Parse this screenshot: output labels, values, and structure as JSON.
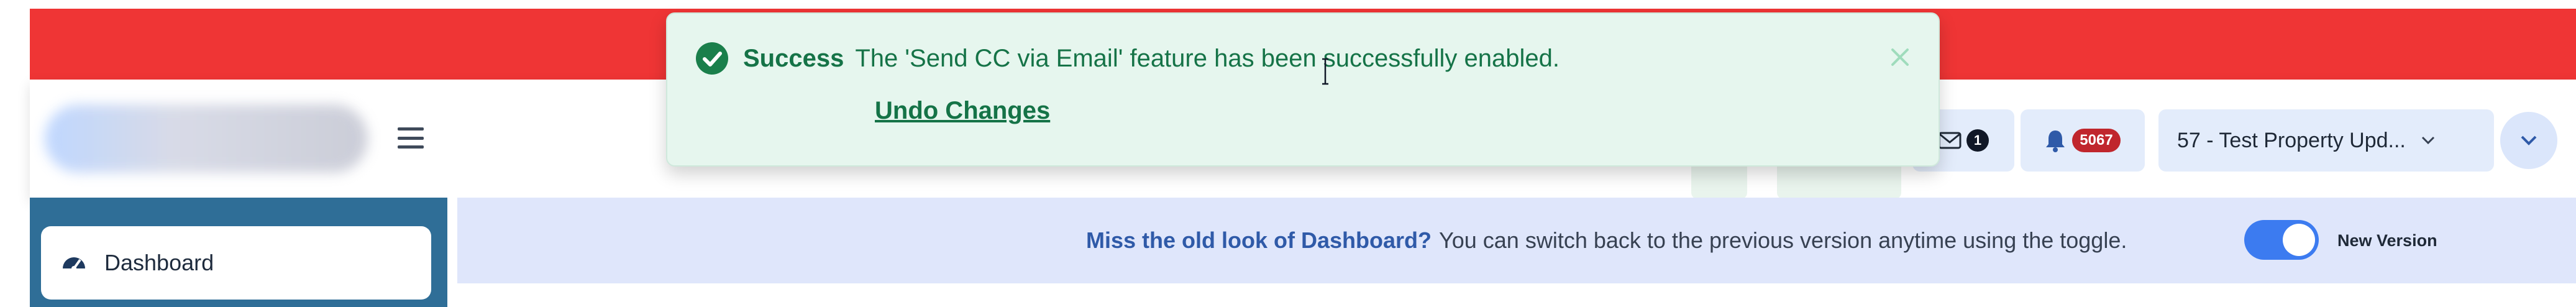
{
  "toast": {
    "title": "Success",
    "message": "The 'Send CC via Email' feature has been successfully enabled.",
    "undo_label": "Undo Changes"
  },
  "header": {
    "mail_count": "1",
    "notification_count": "5067",
    "property_selector_value": "57 - Test Property Upd..."
  },
  "sidebar": {
    "items": [
      {
        "label": "Dashboard"
      }
    ]
  },
  "banner": {
    "strong_text": "Miss the old look of Dashboard?",
    "text": "You can switch back to the previous version anytime using the toggle.",
    "toggle_label": "New Version",
    "toggle_on": true
  },
  "colors": {
    "alert_red": "#ef3535",
    "success_green": "#157347",
    "toast_background": "#e6f6ee",
    "sidebar_blue": "#2f6e97",
    "info_background": "#dfe6fb",
    "toggle_blue": "#3c7bf0",
    "badge_red": "#c0262d"
  },
  "icons": {
    "toast": [
      "check-circle-icon",
      "close-icon"
    ],
    "header": [
      "hamburger-menu-icon",
      "mail-icon",
      "bell-icon",
      "chevron-down-icon"
    ],
    "sidebar": [
      "dashboard-gauge-icon"
    ],
    "pointer": "text-cursor-icon"
  }
}
